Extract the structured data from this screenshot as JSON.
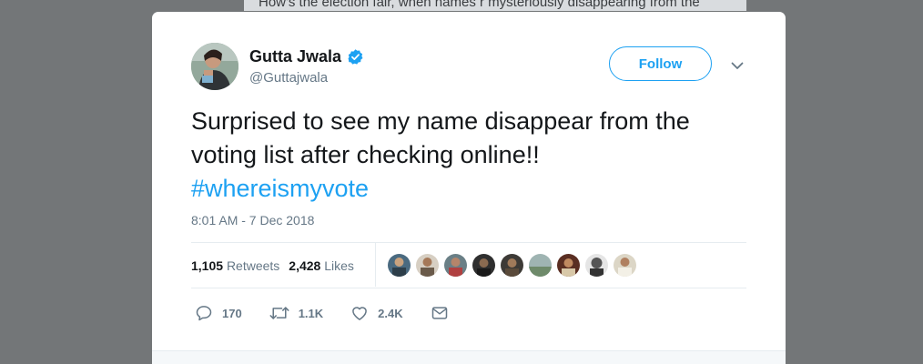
{
  "background_tweet": {
    "text": "How's the election fair, when names r mysteriously disappearing from the"
  },
  "tweet": {
    "author_name": "Gutta Jwala",
    "author_handle": "@Guttajwala",
    "verified": true,
    "follow_label": "Follow",
    "text_line1": "Surprised to see my name disappear from the",
    "text_line2": "voting list after checking online!!",
    "hashtag": "#whereismyvote",
    "timestamp": "8:01 AM - 7 Dec 2018",
    "retweets_count": "1,105",
    "retweets_label": "Retweets",
    "likes_count": "2,428",
    "likes_label": "Likes",
    "liker_avatars": 9
  },
  "actions": {
    "reply_count": "170",
    "retweet_count": "1.1K",
    "like_count": "2.4K"
  },
  "colors": {
    "accent": "#1da1f2",
    "text": "#14171a",
    "secondary": "#657786",
    "backdrop": "#737678"
  }
}
